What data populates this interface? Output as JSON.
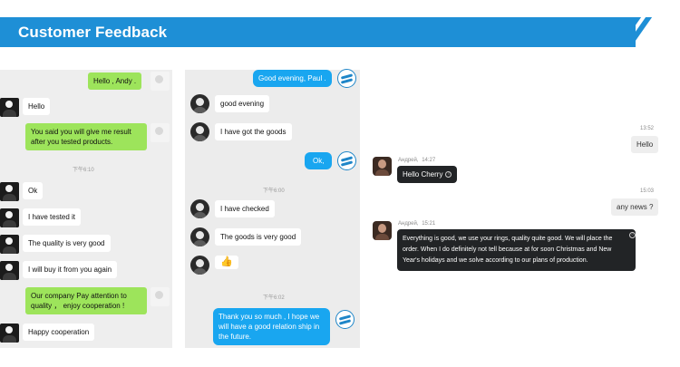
{
  "header": {
    "title": "Customer Feedback"
  },
  "chat1": {
    "timestamp": "下午6:10",
    "messages": [
      {
        "side": "right",
        "text": "Hello , Andy ."
      },
      {
        "side": "left",
        "text": "Hello"
      },
      {
        "side": "left",
        "text": "You said you will give me result after you tested products."
      },
      {
        "side": "left",
        "text": "Ok"
      },
      {
        "side": "left",
        "text": "I have tested it"
      },
      {
        "side": "left",
        "text": "The quality is very good"
      },
      {
        "side": "left",
        "text": "I will buy it from you again"
      },
      {
        "side": "right",
        "text": "Our company Pay attention to quality ， enjoy cooperation !"
      },
      {
        "side": "left",
        "text": "Happy cooperation"
      }
    ]
  },
  "chat2": {
    "timestamp1": "下午6:00",
    "timestamp2": "下午6:02",
    "messages": [
      {
        "side": "right",
        "text": "Good evening, Paul ."
      },
      {
        "side": "left",
        "text": "good evening"
      },
      {
        "side": "left",
        "text": "I have got the goods"
      },
      {
        "side": "right",
        "text": "Ok,"
      },
      {
        "side": "left",
        "text": "I have checked"
      },
      {
        "side": "left",
        "text": "The goods is very good"
      },
      {
        "side": "left",
        "text": "👍"
      },
      {
        "side": "right",
        "text": "Thank you so much , I hope we will have a good relation ship in the future."
      }
    ]
  },
  "chat3": {
    "time1": "13:52",
    "time2": "15:03",
    "messages": [
      {
        "side": "right",
        "text": "Hello"
      },
      {
        "side": "left",
        "sender": "Андрей,",
        "time": "14:27",
        "text": "Hello Cherry"
      },
      {
        "side": "right",
        "text": "any news ?"
      },
      {
        "side": "left",
        "sender": "Андрей,",
        "time": "15:21",
        "text": "Everything is good, we use your rings, quality quite good. We will place the order. When I do definitely not tell because at for soon Christmas and New Year's holidays and we solve according to our plans of production."
      }
    ]
  },
  "colors": {
    "banner": "#1e8fd6",
    "green_bubble": "#9de45b",
    "blue_bubble": "#19a6f0",
    "dark_bubble": "#222426"
  }
}
